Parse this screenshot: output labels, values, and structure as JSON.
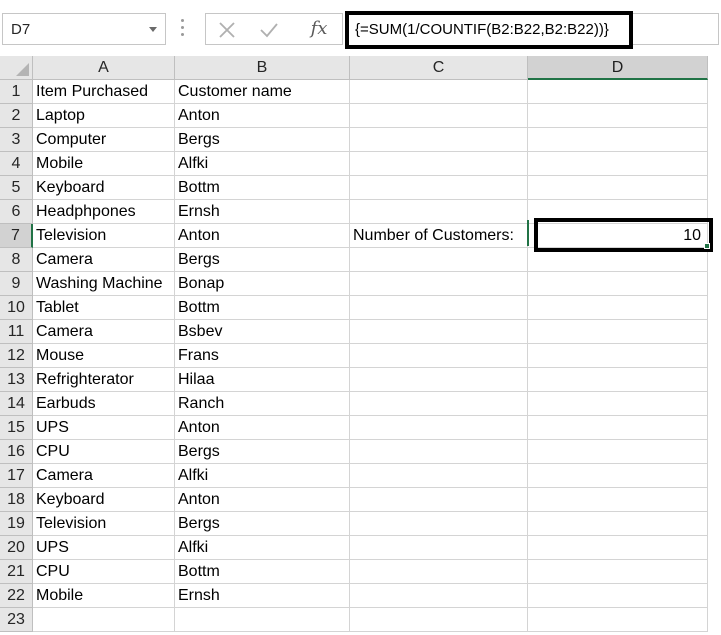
{
  "formula_bar": {
    "name_box": "D7",
    "cancel_icon": "x-icon",
    "enter_icon": "checkmark-icon",
    "function_label": "fx",
    "formula": "{=SUM(1/COUNTIF(B2:B22,B2:B22))}"
  },
  "columns": [
    "A",
    "B",
    "C",
    "D"
  ],
  "active_column": "D",
  "active_row": "7",
  "rows": [
    {
      "num": "1",
      "a": "Item Purchased",
      "b": "Customer name",
      "c": "",
      "d": ""
    },
    {
      "num": "2",
      "a": "Laptop",
      "b": "Anton",
      "c": "",
      "d": ""
    },
    {
      "num": "3",
      "a": "Computer",
      "b": "Bergs",
      "c": "",
      "d": ""
    },
    {
      "num": "4",
      "a": "Mobile",
      "b": "Alfki",
      "c": "",
      "d": ""
    },
    {
      "num": "5",
      "a": "Keyboard",
      "b": "Bottm",
      "c": "",
      "d": ""
    },
    {
      "num": "6",
      "a": "Headphpones",
      "b": "Ernsh",
      "c": "",
      "d": ""
    },
    {
      "num": "7",
      "a": "Television",
      "b": "Anton",
      "c": "Number of Customers:",
      "d": "10"
    },
    {
      "num": "8",
      "a": "Camera",
      "b": "Bergs",
      "c": "",
      "d": ""
    },
    {
      "num": "9",
      "a": "Washing Machine",
      "b": "Bonap",
      "c": "",
      "d": ""
    },
    {
      "num": "10",
      "a": "Tablet",
      "b": "Bottm",
      "c": "",
      "d": ""
    },
    {
      "num": "11",
      "a": "Camera",
      "b": "Bsbev",
      "c": "",
      "d": ""
    },
    {
      "num": "12",
      "a": "Mouse",
      "b": "Frans",
      "c": "",
      "d": ""
    },
    {
      "num": "13",
      "a": "Refrighterator",
      "b": "Hilaa",
      "c": "",
      "d": ""
    },
    {
      "num": "14",
      "a": "Earbuds",
      "b": "Ranch",
      "c": "",
      "d": ""
    },
    {
      "num": "15",
      "a": "UPS",
      "b": "Anton",
      "c": "",
      "d": ""
    },
    {
      "num": "16",
      "a": "CPU",
      "b": "Bergs",
      "c": "",
      "d": ""
    },
    {
      "num": "17",
      "a": "Camera",
      "b": "Alfki",
      "c": "",
      "d": ""
    },
    {
      "num": "18",
      "a": "Keyboard",
      "b": "Anton",
      "c": "",
      "d": ""
    },
    {
      "num": "19",
      "a": "Television",
      "b": "Bergs",
      "c": "",
      "d": ""
    },
    {
      "num": "20",
      "a": "UPS",
      "b": "Alfki",
      "c": "",
      "d": ""
    },
    {
      "num": "21",
      "a": "CPU",
      "b": "Bottm",
      "c": "",
      "d": ""
    },
    {
      "num": "22",
      "a": "Mobile",
      "b": "Ernsh",
      "c": "",
      "d": ""
    },
    {
      "num": "23",
      "a": "",
      "b": "",
      "c": "",
      "d": ""
    }
  ]
}
